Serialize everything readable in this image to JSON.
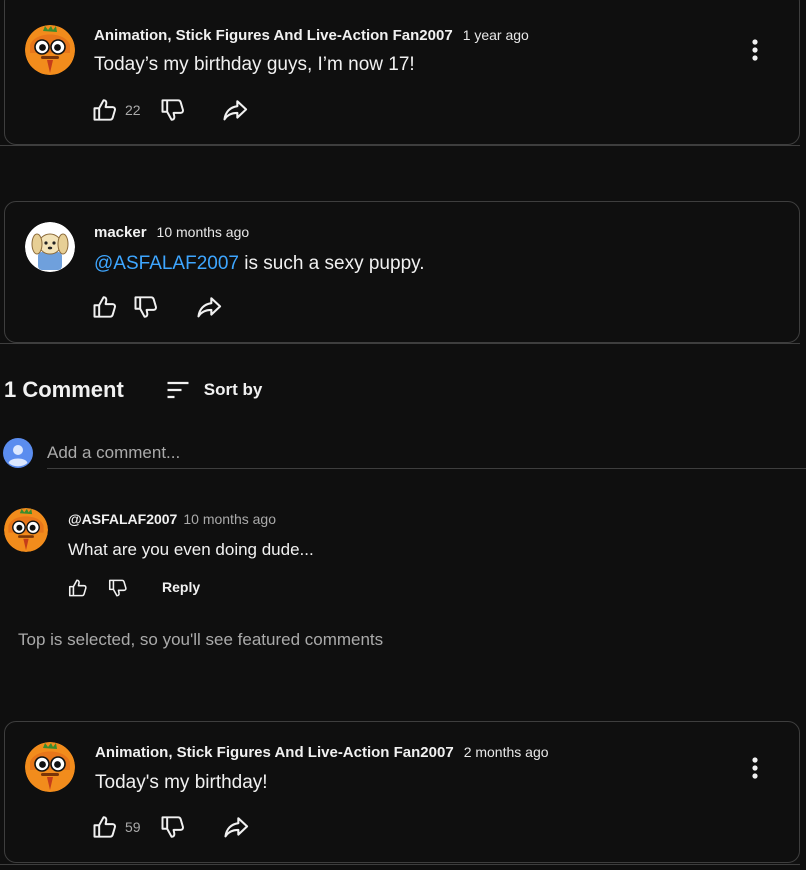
{
  "posts": [
    {
      "author": "Animation, Stick Figures And Live-Action Fan2007",
      "time": "1 year ago",
      "text": "Today’s my birthday guys, I’m now 17!",
      "likes": "22",
      "avatar_icon": "pumpkin-cartoon-avatar"
    },
    {
      "author": "macker",
      "time": "10 months ago",
      "mention": "@ASFALAF2007",
      "text": " is such a sexy puppy.",
      "likes": "",
      "avatar_icon": "dog-cartoon-avatar"
    },
    {
      "author": "Animation, Stick Figures And Live-Action Fan2007",
      "time": "2 months ago",
      "text": "Today's my birthday!",
      "likes": "59",
      "avatar_icon": "pumpkin-cartoon-avatar"
    }
  ],
  "comments_section": {
    "count_label": "1 Comment",
    "sort_label": "Sort by",
    "add_comment_placeholder": "Add a comment...",
    "comments": [
      {
        "author": "@ASFALAF2007",
        "time": "10 months ago",
        "text": "What are you even doing dude...",
        "reply_label": "Reply"
      }
    ],
    "notice": "Top is selected, so you'll see featured comments"
  },
  "colors": {
    "background": "#0f0f0f",
    "border": "#3e3e3e",
    "text": "#f1f1f1",
    "secondary_text": "#aaaaaa",
    "mention": "#3ea6ff",
    "avatar_orange": "#f28c1c",
    "user_avatar_blue": "#5b8def"
  }
}
